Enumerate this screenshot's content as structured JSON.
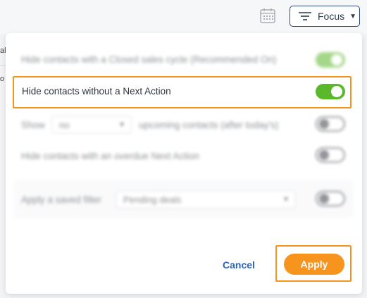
{
  "toolbar": {
    "calendar_icon": "calendar-icon",
    "focus_label": "Focus",
    "filter_icon": "filter-lines-icon",
    "caret_icon": "caret-down-icon"
  },
  "panel": {
    "rows": [
      {
        "label": "Hide contacts with a Closed sales cycle (Recommended On)",
        "toggle": true
      },
      {
        "label": "Hide contacts without a Next Action",
        "toggle": true
      },
      {
        "show_label": "Show",
        "select_value": "no",
        "suffix": "upcoming contacts (after today's)",
        "toggle": false
      },
      {
        "label": "Hide contacts with an overdue Next Action",
        "toggle": false
      },
      {
        "label": "Apply a saved filter",
        "select_value": "Pending deals",
        "toggle": false
      }
    ],
    "cancel_label": "Cancel",
    "apply_label": "Apply"
  },
  "edge": {
    "text1": "al",
    "text2": "o"
  },
  "colors": {
    "accent_orange": "#f7941d",
    "toggle_on": "#5cb82b",
    "link_blue": "#2f63b5",
    "border_navy": "#2c4a7a"
  }
}
